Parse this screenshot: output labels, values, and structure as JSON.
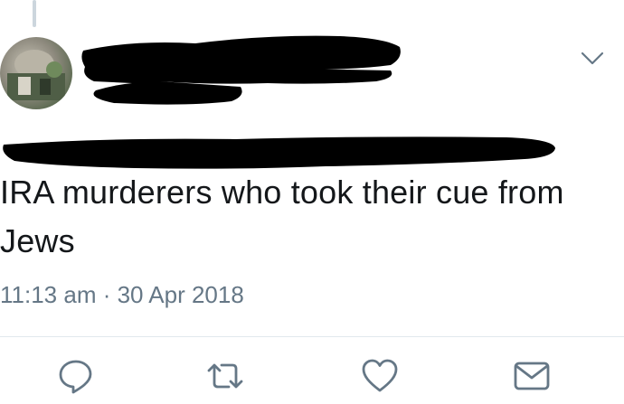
{
  "tweet": {
    "text_lines": [
      "IRA murderers who took their cue from",
      "Jews"
    ],
    "timestamp": "11:13 am · 30 Apr 2018"
  },
  "icons": {
    "menu": "chevron-down-icon",
    "reply": "reply-icon",
    "retweet": "retweet-icon",
    "like": "heart-icon",
    "dm": "envelope-icon"
  },
  "colors": {
    "text": "#14171a",
    "secondary": "#657786",
    "icon": "#657786",
    "redaction": "#000000"
  }
}
